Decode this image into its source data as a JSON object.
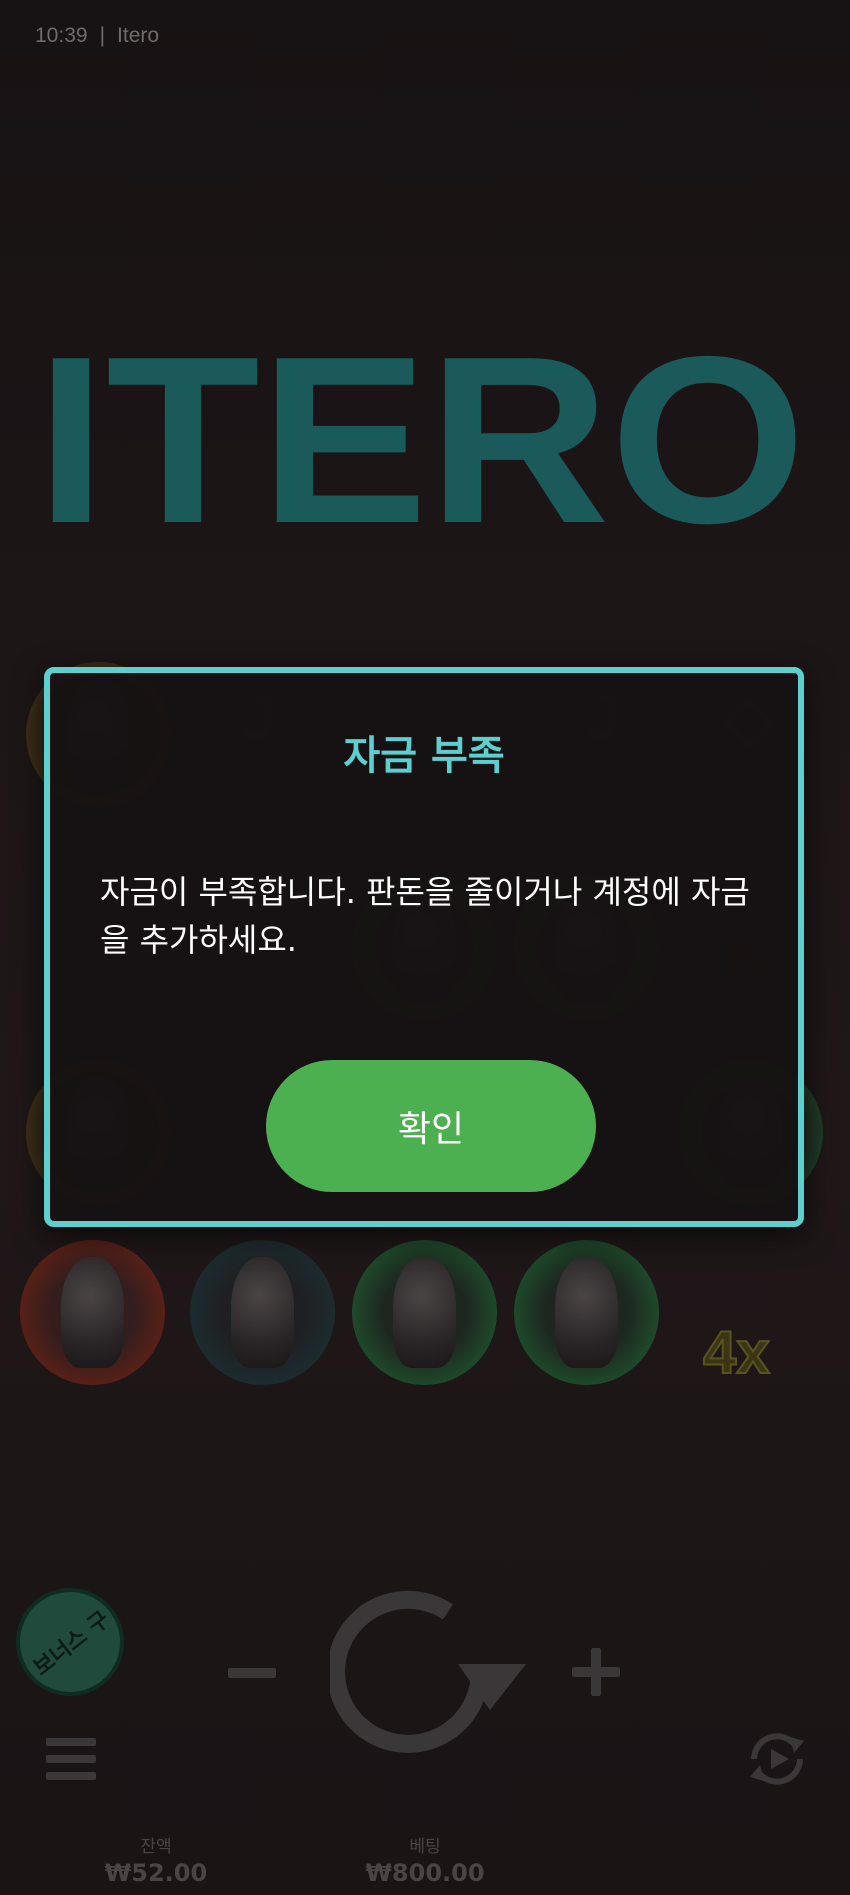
{
  "status_bar": {
    "time": "10:39",
    "separator": "|",
    "app_name": "Itero"
  },
  "logo": {
    "text": "ITERO",
    "color": "#1a5a5a"
  },
  "reels": {
    "symbols": [
      "zeus-bust",
      "card-j",
      "card-j",
      "card-diamond",
      "card-k",
      "david-bust",
      "david-bust",
      "card-k",
      "zeus-bust",
      "card-10",
      "card-k",
      "david-bust",
      "zeus-bust",
      "maiden-bust",
      "david-bust",
      "david-bust"
    ],
    "multiplier": "4x"
  },
  "modal": {
    "title": "자금 부족",
    "message": "자금이 부족합니다. 판돈을 줄이거나 계정에 자금을 추가하세요.",
    "confirm_label": "확인",
    "border_color": "#5ccfcf",
    "button_color": "#4caf50"
  },
  "controls": {
    "bonus_buy_label": "보너스 구",
    "minus_icon": "minus-icon",
    "plus_icon": "plus-icon",
    "spin_icon": "spin-icon",
    "menu_icon": "menu-icon",
    "autoplay_icon": "autoplay-icon"
  },
  "footer": {
    "balance_label": "잔액",
    "balance_value": "₩52.00",
    "bet_label": "베팅",
    "bet_value": "₩800.00"
  }
}
